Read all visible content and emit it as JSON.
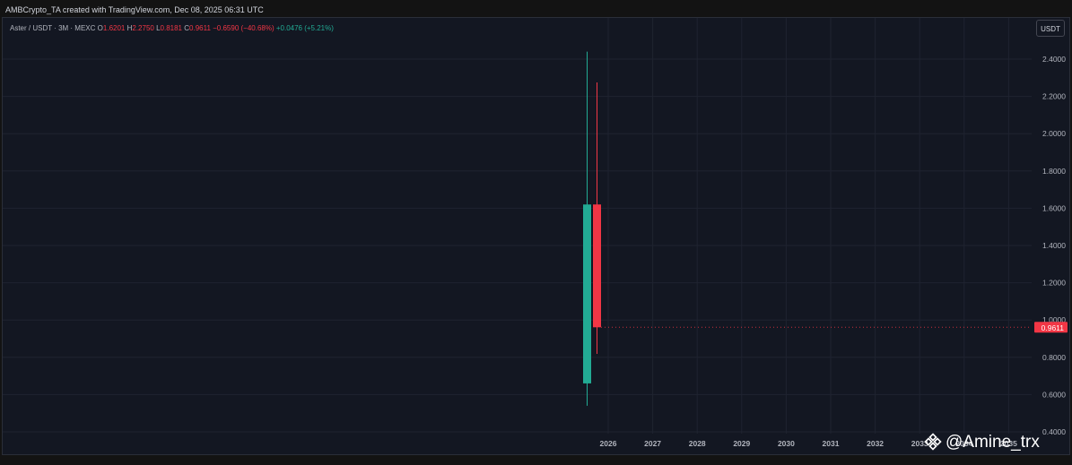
{
  "header": {
    "caption": "AMBCrypto_TA created with TradingView.com, Dec 08, 2025 06:31 UTC"
  },
  "legend": {
    "symbol": "Aster / USDT · 3M · MEXC",
    "open_label": "O",
    "open_value": "1.6201",
    "high_label": "H",
    "high_value": "2.2750",
    "low_label": "L",
    "low_value": "0.8181",
    "close_label": "C",
    "close_value": "0.9611",
    "change": "−0.6590 (−40.68%)",
    "volume_change": "+0.0476 (+5.21%)"
  },
  "currency_button": "USDT",
  "last_price_label": "0.9611",
  "watermark": "@Amine_trx",
  "colors": {
    "background": "#131722",
    "grid": "#1f2330",
    "up": "#22ab94",
    "down": "#f23645",
    "axis_text": "#b2b5be"
  },
  "chart_data": {
    "type": "candlestick",
    "y_ticks": [
      "2.4000",
      "2.2000",
      "2.0000",
      "1.8000",
      "1.6000",
      "1.4000",
      "1.2000",
      "1.0000",
      "0.8000",
      "0.6000",
      "0.4000"
    ],
    "x_ticks": [
      "2026",
      "2027",
      "2028",
      "2029",
      "2030",
      "2031",
      "2032",
      "2033",
      "2034",
      "2035"
    ],
    "ylim": [
      0.39,
      2.55
    ],
    "candles": [
      {
        "date": "2025-09",
        "open": 0.66,
        "high": 2.44,
        "low": 0.54,
        "close": 1.62,
        "direction": "up"
      },
      {
        "date": "2025-12",
        "open": 1.6201,
        "high": 2.275,
        "low": 0.8181,
        "close": 0.9611,
        "direction": "down"
      }
    ],
    "last_price": 0.9611,
    "grid": true
  }
}
